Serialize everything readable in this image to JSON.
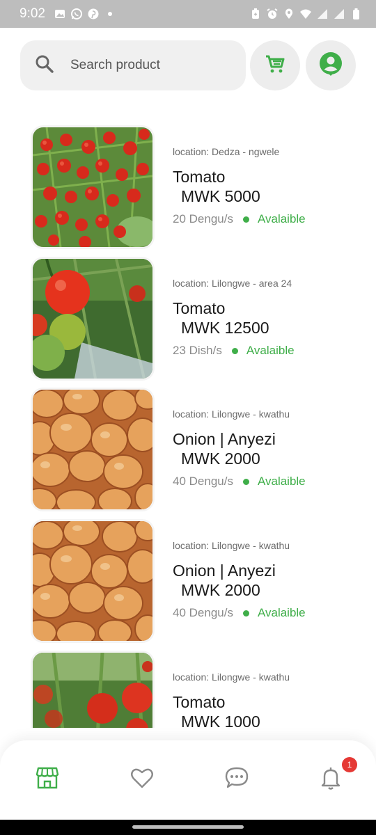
{
  "status_bar": {
    "time": "9:02",
    "left_icons": [
      "image-icon",
      "whatsapp-icon",
      "pinterest-icon",
      "dot-icon"
    ],
    "right_icons": [
      "battery-saver-icon",
      "alarm-icon",
      "location-icon",
      "wifi-icon",
      "signal-icon",
      "signal-icon",
      "battery-icon"
    ]
  },
  "header": {
    "search_placeholder": "Search product",
    "cart_icon": "cart-icon",
    "profile_icon": "profile-icon"
  },
  "colors": {
    "accent": "#3fae49",
    "badge": "#e53935",
    "search_bg": "#f0f0f0"
  },
  "products": [
    {
      "location": "location: Dedza - ngwele",
      "name": "Tomato",
      "price": "MWK 5000",
      "qty": "20 Dengu/s",
      "status": "Avalaible",
      "image": "cherry-tomatoes"
    },
    {
      "location": "location: Lilongwe - area 24",
      "name": "Tomato",
      "price": "MWK 12500",
      "qty": "23 Dish/s",
      "status": "Avalaible",
      "image": "vine-tomatoes"
    },
    {
      "location": "location: Lilongwe - kwathu",
      "name": "Onion | Anyezi",
      "price": "MWK 2000",
      "qty": "40 Dengu/s",
      "status": "Avalaible",
      "image": "onions"
    },
    {
      "location": "location: Lilongwe - kwathu",
      "name": "Onion | Anyezi",
      "price": "MWK 2000",
      "qty": "40 Dengu/s",
      "status": "Avalaible",
      "image": "onions"
    },
    {
      "location": "location: Lilongwe - kwathu",
      "name": "Tomato",
      "price": "MWK 1000",
      "qty": "",
      "status": "",
      "image": "garden-tomatoes"
    }
  ],
  "bottom_nav": {
    "items": [
      "store-icon",
      "heart-icon",
      "chat-icon",
      "bell-icon"
    ],
    "notification_count": "1"
  }
}
